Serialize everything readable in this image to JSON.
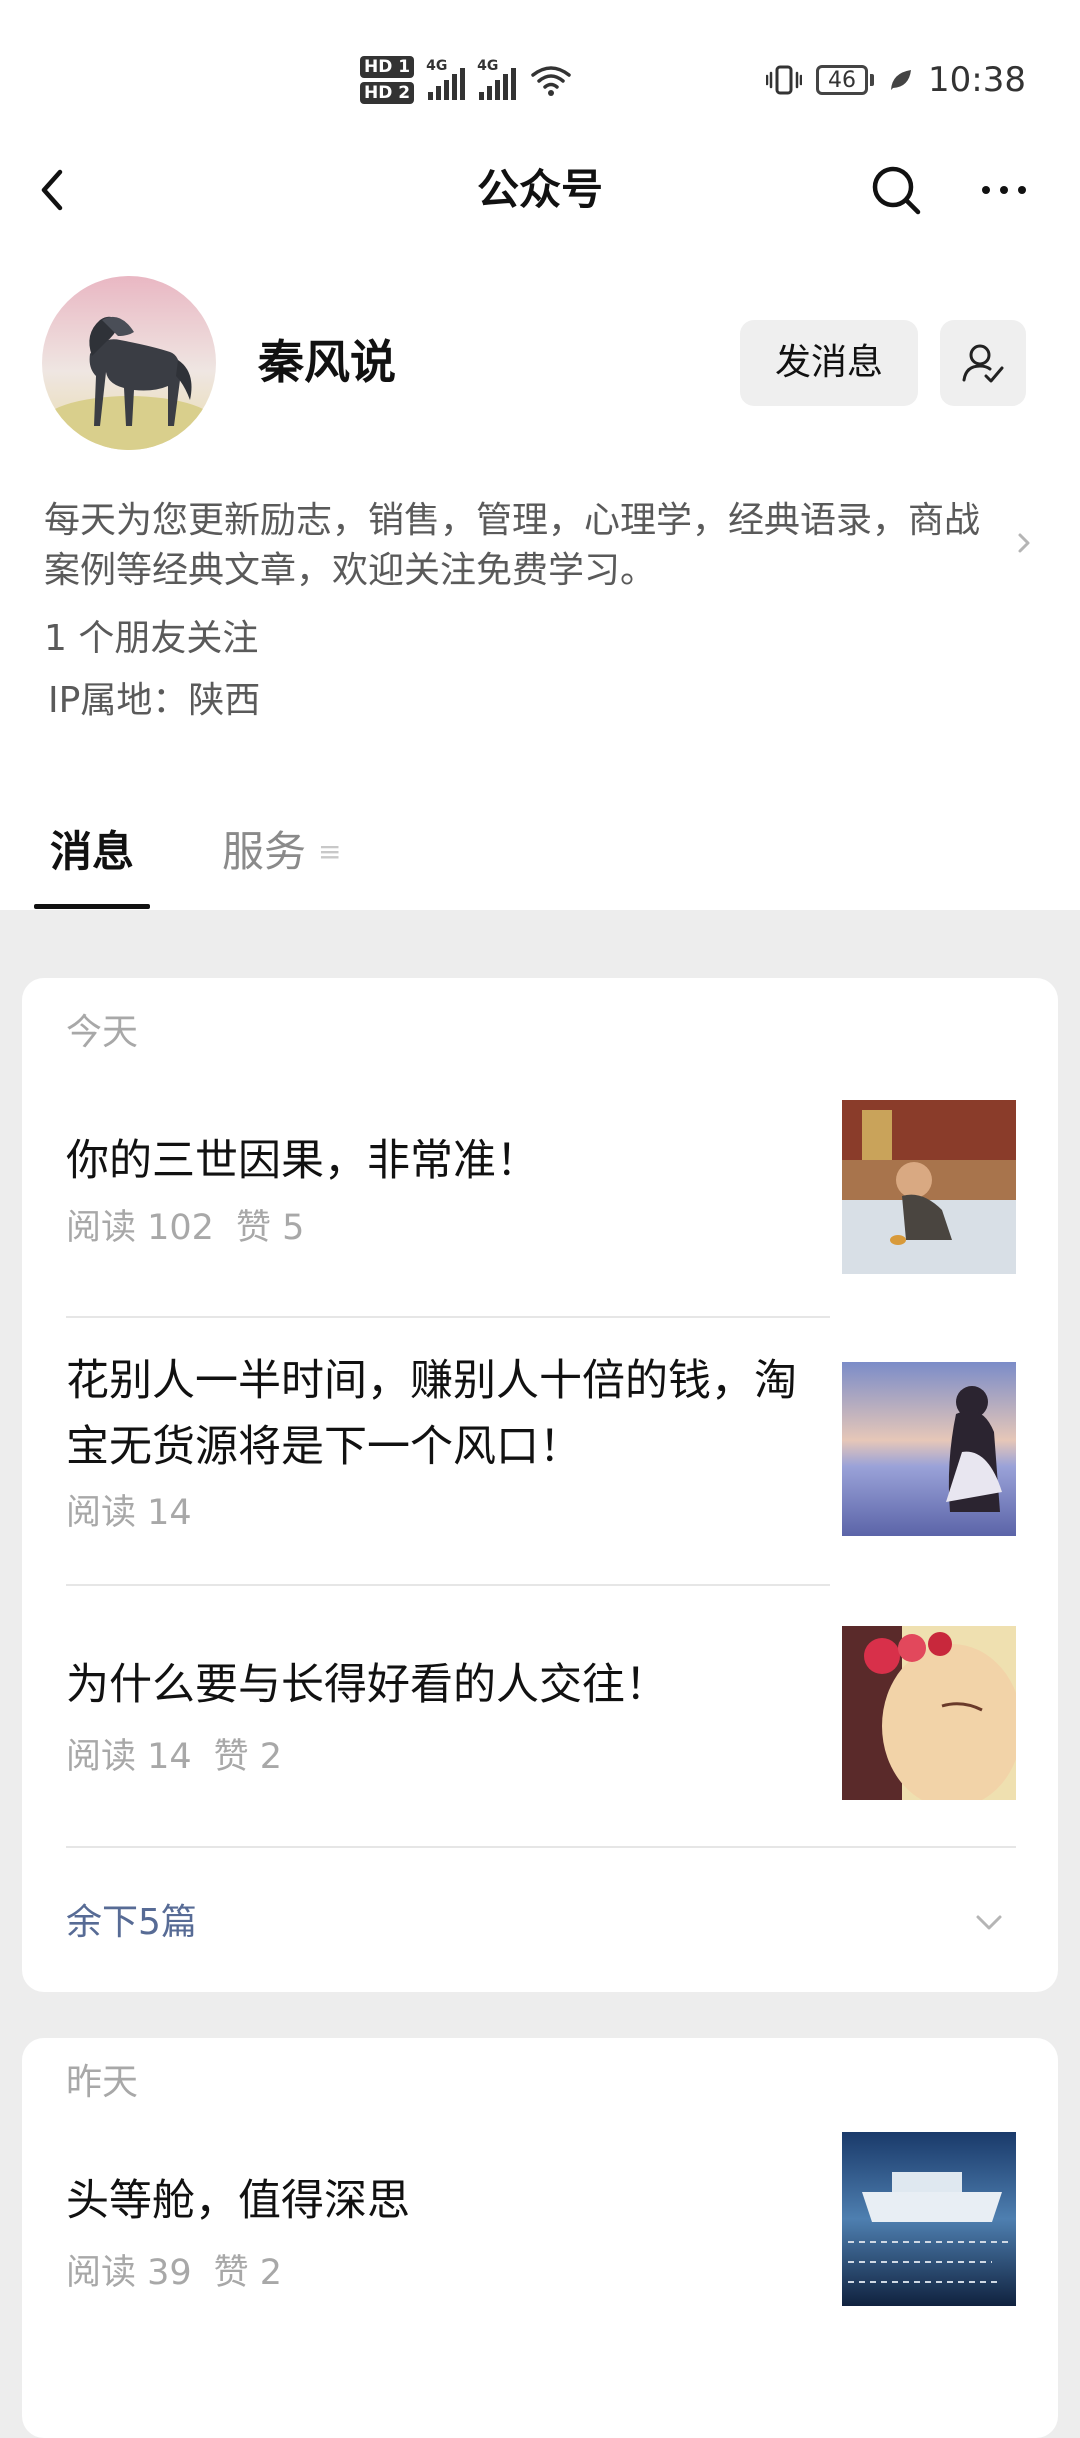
{
  "status_bar": {
    "hd1": "HD 1",
    "hd2": "HD 2",
    "net1": "4G",
    "net2": "4G",
    "battery": "46",
    "time": "10:38"
  },
  "nav": {
    "title": "公众号",
    "icons": [
      "back-arrow-icon",
      "search-icon",
      "more-icon"
    ]
  },
  "profile": {
    "name": "秦风说",
    "send_message_label": "发消息",
    "description": "每天为您更新励志，销售，管理，心理学，经典语录，商战案例等经典文章，欢迎关注免费学习。",
    "friends_following": "1 个朋友关注",
    "ip_location": "IP属地：陕西"
  },
  "tabs": [
    {
      "label": "消息",
      "active": true
    },
    {
      "label": "服务",
      "active": false
    }
  ],
  "feed": [
    {
      "date": "今天",
      "articles": [
        {
          "title": "你的三世因果，非常准！",
          "reads": "阅读 102",
          "likes": "赞 5",
          "thumb": "child-sitting-photo"
        },
        {
          "title": "花别人一半时间，赚别人十倍的钱，淘宝无货源将是下一个风口！",
          "reads": "阅读 14",
          "likes": "",
          "thumb": "girl-at-seaside-photo"
        },
        {
          "title": "为什么要与长得好看的人交往！",
          "reads": "阅读 14",
          "likes": "赞 2",
          "thumb": "woman-with-flowers-photo"
        }
      ],
      "more_label": "余下5篇"
    },
    {
      "date": "昨天",
      "articles": [
        {
          "title": "头等舱，值得深思",
          "reads": "阅读 39",
          "likes": "赞 2",
          "thumb": "ship-calligraphy-photo"
        }
      ]
    }
  ],
  "colors": {
    "page_bg": "#ededed",
    "card_bg": "#ffffff",
    "link_blue": "#576b95",
    "muted_text": "#a8a8a8",
    "button_bg": "#efefef"
  }
}
